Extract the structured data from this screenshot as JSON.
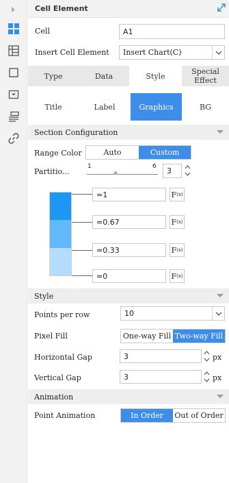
{
  "rail": {
    "icons": [
      "expand-arrow-icon",
      "cell-element-icon",
      "table-grid-icon",
      "frame-icon",
      "dropdown-box-icon",
      "form-list-icon",
      "link-icon"
    ]
  },
  "header": {
    "title": "Cell Element",
    "expand_icon": "collapse-arrows-icon"
  },
  "cell": {
    "label": "Cell",
    "value": "A1"
  },
  "insert": {
    "label": "Insert Cell Element",
    "value": "Insert Chart(C)"
  },
  "tabs": [
    "Type",
    "Data",
    "Style",
    "Special Effect"
  ],
  "active_tab": "Style",
  "subtabs": [
    "Title",
    "Label",
    "Graphics",
    "BG"
  ],
  "active_subtab": "Graphics",
  "section_config": {
    "title": "Section Configuration",
    "range_color": {
      "label": "Range Color",
      "options": [
        "Auto",
        "Custom"
      ],
      "selected": "Custom"
    },
    "partition": {
      "label": "Partitio...",
      "min": "1",
      "max": "6",
      "value": "3",
      "level": 0.4
    },
    "ranges": [
      {
        "value": "=1",
        "color": "#1e97f2"
      },
      {
        "value": "=0.67",
        "color": "#62b8f8"
      },
      {
        "value": "=0.33",
        "color": "#b5dcfc"
      },
      {
        "value": "=0"
      }
    ],
    "fx_label": "F",
    "fx_sub": "(x)"
  },
  "style": {
    "title": "Style",
    "points_per_row": {
      "label": "Points per row",
      "value": "10"
    },
    "pixel_fill": {
      "label": "Pixel Fill",
      "options": [
        "One-way Fill",
        "Two-way Fill"
      ],
      "selected": "Two-way Fill"
    },
    "horizontal_gap": {
      "label": "Horizontal Gap",
      "value": "3",
      "unit": "px"
    },
    "vertical_gap": {
      "label": "Vertical Gap",
      "value": "3",
      "unit": "px"
    }
  },
  "animation": {
    "title": "Animation",
    "point_animation": {
      "label": "Point Animation",
      "options": [
        "In Order",
        "Out of Order"
      ],
      "selected": "In Order"
    }
  },
  "colors": {
    "accent": "#3d8ee8",
    "section_bg": "#eeeeee"
  }
}
